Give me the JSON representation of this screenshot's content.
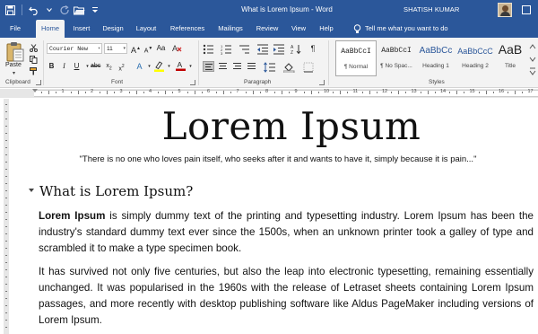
{
  "window": {
    "title": "What is Lorem Ipsum  -  Word",
    "user": "SHATISH KUMAR"
  },
  "tabs": [
    {
      "label": "File"
    },
    {
      "label": "Home"
    },
    {
      "label": "Insert"
    },
    {
      "label": "Design"
    },
    {
      "label": "Layout"
    },
    {
      "label": "References"
    },
    {
      "label": "Mailings"
    },
    {
      "label": "Review"
    },
    {
      "label": "View"
    },
    {
      "label": "Help"
    }
  ],
  "tell_me": "Tell me what you want to do",
  "ribbon": {
    "clipboard": {
      "label": "Clipboard",
      "paste": "Paste"
    },
    "font": {
      "label": "Font",
      "family": "Courier New",
      "size": "11"
    },
    "paragraph": {
      "label": "Paragraph"
    },
    "styles": {
      "label": "Styles",
      "items": [
        {
          "preview": "AaBbCcI",
          "name": "¶ Normal"
        },
        {
          "preview": "AaBbCcI",
          "name": "¶ No Spac..."
        },
        {
          "preview": "AaBbCc",
          "name": "Heading 1"
        },
        {
          "preview": "AaBbCcC",
          "name": "Heading 2"
        },
        {
          "preview": "AaB",
          "name": "Title"
        }
      ]
    }
  },
  "ruler": {
    "numbers": [
      "1",
      "2",
      "3",
      "4",
      "5",
      "6",
      "7",
      "8",
      "9",
      "10",
      "11",
      "12",
      "13",
      "14",
      "15",
      "16",
      "17"
    ]
  },
  "document": {
    "title": "Lorem Ipsum",
    "quote": "\"There is no one who loves pain itself, who seeks after it and wants to have it, simply because it is pain...\"",
    "heading": "What is Lorem Ipsum?",
    "p1_bold": "Lorem Ipsum",
    "p1_rest": " is simply dummy text of the printing and typesetting industry. Lorem Ipsum has been the industry's standard dummy text ever since the 1500s, when an unknown printer took a galley of type and scrambled it to make a type specimen book.",
    "p2": "It has survived not only five centuries, but also the leap into electronic typesetting, remaining essentially unchanged. It was popularised in the 1960s with the release of Letraset sheets containing Lorem Ipsum passages, and more recently with desktop publishing software like Aldus PageMaker including versions of Lorem Ipsum."
  },
  "icons": [
    "save-icon",
    "undo-icon",
    "redo-icon",
    "open-icon",
    "customize-qat-icon",
    "lightbulb-icon",
    "restore-icon"
  ],
  "colors": {
    "accent": "#2b579a",
    "ribbon": "#f3f3f3",
    "highlight": "#ffff00",
    "font_color": "#c00000"
  }
}
